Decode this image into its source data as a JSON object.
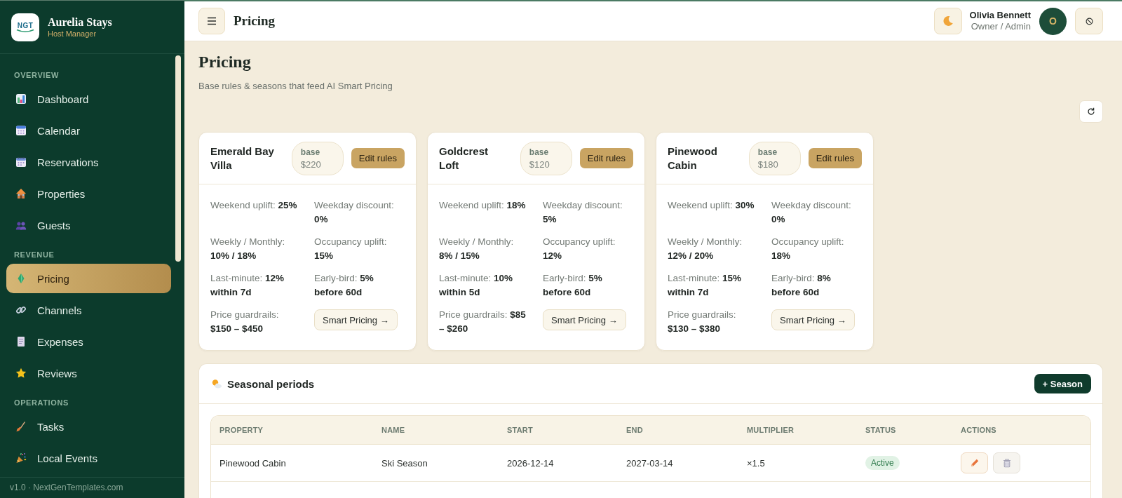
{
  "sidebar": {
    "brand": {
      "logo_text": "NGT",
      "name": "Aurelia Stays",
      "tagline": "Host Manager"
    },
    "sections": [
      {
        "label": "OVERVIEW",
        "items": [
          {
            "label": "Dashboard",
            "selected": false
          },
          {
            "label": "Calendar",
            "selected": false
          },
          {
            "label": "Reservations",
            "selected": false
          },
          {
            "label": "Properties",
            "selected": false
          },
          {
            "label": "Guests",
            "selected": false
          }
        ]
      },
      {
        "label": "REVENUE",
        "items": [
          {
            "label": "Pricing",
            "selected": true
          },
          {
            "label": "Channels",
            "selected": false
          },
          {
            "label": "Expenses",
            "selected": false
          },
          {
            "label": "Reviews",
            "selected": false
          }
        ]
      },
      {
        "label": "OPERATIONS",
        "items": [
          {
            "label": "Tasks",
            "selected": false
          },
          {
            "label": "Local Events",
            "selected": false
          }
        ]
      }
    ],
    "footer": "v1.0 · NextGenTemplates.com"
  },
  "topbar": {
    "title": "Pricing",
    "user": {
      "name": "Olivia Bennett",
      "role": "Owner / Admin",
      "initial": "O"
    }
  },
  "page": {
    "title": "Pricing",
    "subtitle": "Base rules & seasons that feed AI Smart Pricing"
  },
  "cards": [
    {
      "name": "Emerald Bay Villa",
      "base_label": "base",
      "base_price": "$220",
      "edit_button": "Edit rules",
      "rules": [
        "Weekend uplift: **25%**",
        "Weekday discount: **0%**",
        "Weekly / Monthly: **10% / 18%**",
        "Occupancy uplift: **15%**",
        "Last-minute: **12% within 7d**",
        "Early-bird: **5% before 60d**",
        "Price guardrails: **$150 – $450**"
      ],
      "action": "Smart Pricing →"
    },
    {
      "name": "Goldcrest Loft",
      "base_label": "base",
      "base_price": "$120",
      "edit_button": "Edit rules",
      "rules": [
        "Weekend uplift: **18%**",
        "Weekday discount: **5%**",
        "Weekly / Monthly: **8% / 15%**",
        "Occupancy uplift: **12%**",
        "Last-minute: **10% within 5d**",
        "Early-bird: **5% before 60d**",
        "Price guardrails: **$85 – $260**"
      ],
      "action": "Smart Pricing →"
    },
    {
      "name": "Pinewood Cabin",
      "base_label": "base",
      "base_price": "$180",
      "edit_button": "Edit rules",
      "rules": [
        "Weekend uplift: **30%**",
        "Weekday discount: **0%**",
        "Weekly / Monthly: **12% / 20%**",
        "Occupancy uplift: **18%**",
        "Last-minute: **15% within 7d**",
        "Early-bird: **8% before 60d**",
        "Price guardrails: **$130 – $380**"
      ],
      "action": "Smart Pricing →"
    }
  ],
  "seasons": {
    "title": "Seasonal periods",
    "add_button": "+ Season",
    "columns": [
      "PROPERTY",
      "NAME",
      "START",
      "END",
      "MULTIPLIER",
      "STATUS",
      "ACTIONS"
    ],
    "rows": [
      {
        "property": "Pinewood Cabin",
        "name": "Ski Season",
        "start": "2026-12-14",
        "end": "2027-03-14",
        "multiplier": "×1.5",
        "status": "Active"
      }
    ]
  }
}
